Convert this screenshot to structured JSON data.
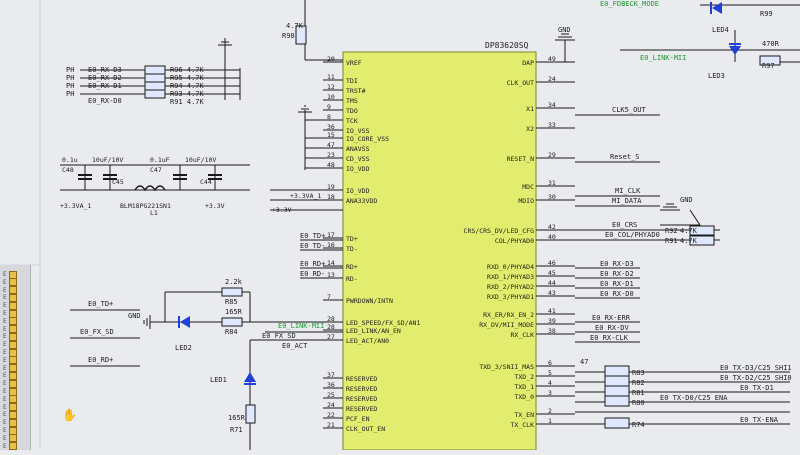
{
  "chip": {
    "name": "DP83620SQ",
    "left_pins": [
      {
        "num": "20",
        "name": "VREF"
      },
      {
        "num": "11",
        "name": "TDI"
      },
      {
        "num": "12",
        "name": "TRST#"
      },
      {
        "num": "10",
        "name": "TMS"
      },
      {
        "num": "9",
        "name": "TDO"
      },
      {
        "num": "8",
        "name": "TCK"
      },
      {
        "num": "36",
        "name": "IO_VSS"
      },
      {
        "num": "15",
        "name": "IO_CORE_VSS"
      },
      {
        "num": "47",
        "name": "ANAVSS"
      },
      {
        "num": "23",
        "name": "CD_VSS"
      },
      {
        "num": "48",
        "name": "IO_VDD"
      },
      {
        "num": "19",
        "name": "IO_VDD"
      },
      {
        "num": "18",
        "name": "ANA33VDD"
      },
      {
        "num": "17",
        "name": "TD+"
      },
      {
        "num": "16",
        "name": "TD-"
      },
      {
        "num": "14",
        "name": "RD+"
      },
      {
        "num": "13",
        "name": "RD-"
      },
      {
        "num": "7",
        "name": "PWRDOWN/INTN"
      },
      {
        "num": "27",
        "name": "LED_ACT/AN0"
      },
      {
        "num": "28",
        "name": "LED_SPEED/FX_SD/AN1"
      },
      {
        "num": "28",
        "name": "LED_LINK/AN_EN"
      },
      {
        "num": "37",
        "name": "RESERVED"
      },
      {
        "num": "36",
        "name": "RESERVED"
      },
      {
        "num": "25",
        "name": "RESERVED"
      },
      {
        "num": "24",
        "name": "RESERVED"
      },
      {
        "num": "22",
        "name": "PCF_EN"
      },
      {
        "num": "21",
        "name": "CLK_OUT_EN"
      }
    ],
    "right_pins": [
      {
        "num": "49",
        "name": "DAP"
      },
      {
        "num": "24",
        "name": "CLK_OUT"
      },
      {
        "num": "34",
        "name": "X1"
      },
      {
        "num": "33",
        "name": "X2"
      },
      {
        "num": "29",
        "name": "RESET_N"
      },
      {
        "num": "31",
        "name": "MDC"
      },
      {
        "num": "30",
        "name": "MDIO"
      },
      {
        "num": "42",
        "name": "CRS/CRS_DV/LED_CFG"
      },
      {
        "num": "40",
        "name": "COL/PHYAD0"
      },
      {
        "num": "46",
        "name": "RXD_0/PHYAD4"
      },
      {
        "num": "45",
        "name": "RXD_1/PHYAD3"
      },
      {
        "num": "44",
        "name": "RXD_2/PHYAD2"
      },
      {
        "num": "43",
        "name": "RXD_3/PHYAD1"
      },
      {
        "num": "41",
        "name": "RX_ER/RX_EN_2"
      },
      {
        "num": "39",
        "name": "RX_DV/MII_MODE"
      },
      {
        "num": "38",
        "name": "RX_CLK"
      },
      {
        "num": "6",
        "name": "TXD_3/SNII_MAS"
      },
      {
        "num": "5",
        "name": "TXD_2"
      },
      {
        "num": "4",
        "name": "TXD_1"
      },
      {
        "num": "3",
        "name": "TXD_0"
      },
      {
        "num": "2",
        "name": "TX_EN"
      },
      {
        "num": "1",
        "name": "TX_CLK"
      }
    ]
  },
  "right_nets": {
    "clk_out": "CLK5_OUT",
    "reset": "Reset_S",
    "mdc": "MI_CLK",
    "mdio": "MI_DATA",
    "crs": "E0_CRS",
    "col": "E0_COL/PHYAD0",
    "rxd0": "E0_RX-D3",
    "rxd1": "E0_RX-D2",
    "rxd2": "E0_RX-D1",
    "rxd3": "E0_RX-D0",
    "rxer": "E0_RX-ERR",
    "rxdv": "E0_RX-DV",
    "rxclk": "E0_RX-CLK",
    "txd3": "E0_TX-D3/C25_SHI1",
    "txd2": "E0_TX-D2/C25_SHI0",
    "txd1": "E0_TX-D1",
    "txd0": "E0_TX-D0/C25_ENA",
    "txen": "E0_TX-ENA"
  },
  "right_resistors": {
    "r92": "R92",
    "r92v": "4.7K",
    "r91": "R91",
    "r91v": "4.7K",
    "r83": "R83",
    "r82": "R82",
    "r81": "R81",
    "r80": "R80",
    "r74": "R74",
    "rv": "47",
    "r97": "R97",
    "r97v": "470R",
    "r99": "R99",
    "led4": "LED4",
    "led3": "LED3",
    "link_net": "E0_LINK-MII",
    "mode_net": "E0_FDBECK_MODE",
    "gnd1": "GND",
    "gnd2": "GND"
  },
  "left_top": {
    "r98": "R98",
    "r98v": "4.7K",
    "rx_nets": [
      "E0_RX-D3",
      "E0_RX-D2",
      "E0_RX-D1",
      "E0_RX-D0"
    ],
    "rx_res": [
      "R96  4.7K",
      "R95  4.7K",
      "R94  4.7K",
      "R93  4.7K"
    ],
    "ph": [
      "PH",
      "PH",
      "PH",
      "PH"
    ],
    "r91": "R91  4.7K"
  },
  "left_power": {
    "caps": [
      "C48",
      "C45",
      "C47",
      "C44"
    ],
    "cap_vals": [
      "0.1u",
      "10uF/10V",
      "0.1uF",
      "10uF/10V"
    ],
    "inductor": "L1",
    "inductor_part": "BLM18PG221SN1",
    "nets": [
      "+3.3VA_1",
      "+3.3V",
      "+3.3VA_1",
      "+3.3V"
    ]
  },
  "left_lower": {
    "td_p": "E0_TD+",
    "td_n": "E0_TD-",
    "rd_p": "E0_RD+",
    "rd_n": "E0_RD-",
    "r85": "R85",
    "r85v": "2.2k",
    "r84": "R84",
    "r84v": "165R",
    "r71": "R71",
    "r71v": "165R",
    "led2": "LED2",
    "led1": "LED1",
    "act": "E0_ACT",
    "fx_sd": "E0_FX_SD",
    "link": "E0_LINK-MII",
    "td_left": "E0_TD+",
    "fx_left": "E0_FX_SD",
    "rd_left": "E0_RD+",
    "gnd": "GND"
  },
  "panel_rows": [
    "E",
    "E",
    "E",
    "E",
    "E",
    "E",
    "E",
    "E",
    "E",
    "E",
    "E",
    "E",
    "E",
    "E",
    "E",
    "E",
    "E",
    "E",
    "E",
    "E",
    "E",
    "E",
    "E"
  ],
  "colors": {
    "chip_fill": "#e2ec6e",
    "wire": "#1a1a1a",
    "resistor_fill": "#dfe8ff",
    "green_net": "#1f9a34",
    "led_blue": "#1f3fd6"
  }
}
